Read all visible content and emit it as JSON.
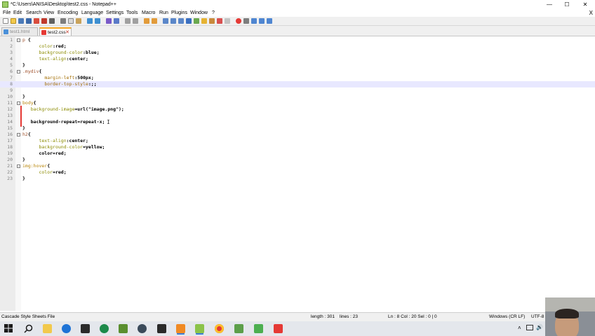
{
  "window": {
    "title": "*C:\\Users\\ANISA\\Desktop\\test2.css - Notepad++",
    "minimize": "—",
    "maximize": "☐",
    "close": "✕"
  },
  "menu": {
    "items": [
      "File",
      "Edit",
      "Search",
      "View",
      "Encoding",
      "Language",
      "Settings",
      "Tools",
      "Macro",
      "Run",
      "Plugins",
      "Window",
      "?"
    ],
    "close_doc": "X"
  },
  "tabs": [
    {
      "label": "test1.html",
      "icon": "saved-file-icon"
    },
    {
      "label": "test2.css",
      "icon": "unsaved-file-icon"
    }
  ],
  "editor": {
    "lines": [
      {
        "n": "1",
        "fold": true,
        "tokens": [
          [
            "p ",
            "sel"
          ],
          [
            "{",
            "brace"
          ]
        ]
      },
      {
        "n": "2",
        "fold": false,
        "tokens": [
          [
            "      ",
            ""
          ],
          [
            "color",
            "prop"
          ],
          [
            ":",
            "punc"
          ],
          [
            "red",
            "val"
          ],
          [
            ";",
            "punc"
          ]
        ]
      },
      {
        "n": "3",
        "fold": false,
        "tokens": [
          [
            "      ",
            ""
          ],
          [
            "background-color",
            "prop"
          ],
          [
            ":",
            "punc"
          ],
          [
            "blue",
            "val"
          ],
          [
            ";",
            "punc"
          ]
        ]
      },
      {
        "n": "4",
        "fold": false,
        "tokens": [
          [
            "      ",
            ""
          ],
          [
            "text-align",
            "prop"
          ],
          [
            ":",
            "punc"
          ],
          [
            "center",
            "val"
          ],
          [
            ";",
            "punc"
          ]
        ]
      },
      {
        "n": "5",
        "fold": false,
        "tokens": [
          [
            "}",
            "brace"
          ]
        ]
      },
      {
        "n": "6",
        "fold": true,
        "tokens": [
          [
            ".mydiv",
            "sel"
          ],
          [
            "{",
            "brace"
          ]
        ]
      },
      {
        "n": "7",
        "fold": false,
        "tokens": [
          [
            "        ",
            ""
          ],
          [
            "margin-left",
            "prop2"
          ],
          [
            ":",
            "punc"
          ],
          [
            "500px",
            "val"
          ],
          [
            ";",
            "punc"
          ]
        ]
      },
      {
        "n": "8",
        "fold": false,
        "tokens": [
          [
            "        ",
            ""
          ],
          [
            "border-top-style",
            "prop2"
          ],
          [
            ":",
            "punc"
          ],
          [
            ";",
            "punc"
          ],
          [
            ";",
            "punc"
          ]
        ]
      },
      {
        "n": "9",
        "fold": false,
        "tokens": []
      },
      {
        "n": "10",
        "fold": false,
        "tokens": [
          [
            "}",
            "brace"
          ]
        ]
      },
      {
        "n": "11",
        "fold": true,
        "tokens": [
          [
            "body",
            "sel2"
          ],
          [
            "{",
            "brace"
          ]
        ]
      },
      {
        "n": "12",
        "fold": false,
        "tokens": [
          [
            "   ",
            ""
          ],
          [
            "background-image",
            "prop"
          ],
          [
            "=url(\"image.png\");",
            "val"
          ]
        ]
      },
      {
        "n": "13",
        "fold": false,
        "tokens": []
      },
      {
        "n": "14",
        "fold": false,
        "tokens": [
          [
            "   ",
            ""
          ],
          [
            "background-repeat=repeat-x;",
            "val"
          ]
        ]
      },
      {
        "n": "15",
        "fold": false,
        "tokens": [
          [
            "}",
            "brace"
          ]
        ]
      },
      {
        "n": "16",
        "fold": true,
        "tokens": [
          [
            "h2",
            "sel"
          ],
          [
            "{",
            "brace"
          ]
        ]
      },
      {
        "n": "17",
        "fold": false,
        "tokens": [
          [
            "      ",
            ""
          ],
          [
            "text-align",
            "prop"
          ],
          [
            ":",
            "punc"
          ],
          [
            "center",
            "val"
          ],
          [
            ";",
            "punc"
          ]
        ]
      },
      {
        "n": "18",
        "fold": false,
        "tokens": [
          [
            "      ",
            ""
          ],
          [
            "background-color",
            "prop"
          ],
          [
            "=yellow;",
            "val"
          ]
        ]
      },
      {
        "n": "19",
        "fold": false,
        "tokens": [
          [
            "      ",
            ""
          ],
          [
            "color=red;",
            "val"
          ]
        ]
      },
      {
        "n": "20",
        "fold": false,
        "tokens": [
          [
            "}",
            "brace"
          ]
        ]
      },
      {
        "n": "21",
        "fold": true,
        "tokens": [
          [
            "img:hover",
            "sel2"
          ],
          [
            "{",
            "brace"
          ]
        ]
      },
      {
        "n": "22",
        "fold": false,
        "tokens": [
          [
            "      ",
            ""
          ],
          [
            "color",
            "prop"
          ],
          [
            "=red;",
            "val"
          ]
        ]
      },
      {
        "n": "23",
        "fold": false,
        "tokens": [
          [
            "}",
            "brace"
          ]
        ]
      }
    ],
    "current_line": "8"
  },
  "status": {
    "file_type": "Cascade Style Sheets File",
    "length": "length : 301",
    "lines": "lines : 23",
    "position": "Ln : 8    Col : 20    Sel : 0 | 0",
    "eol": "Windows (CR LF)",
    "encoding": "UTF-8"
  },
  "taskbar": {
    "apps": [
      "windows-start",
      "search",
      "file-explorer",
      "edge",
      "store",
      "excel",
      "android-studio",
      "snipping-tool",
      "photos",
      "orange-app",
      "notepadpp",
      "chrome",
      "sublime-like",
      "green-app",
      "red-app"
    ]
  },
  "colors": {
    "accent_tab": "#f5a623",
    "current_line": "#e8e8ff",
    "error_marker": "#e53935"
  }
}
